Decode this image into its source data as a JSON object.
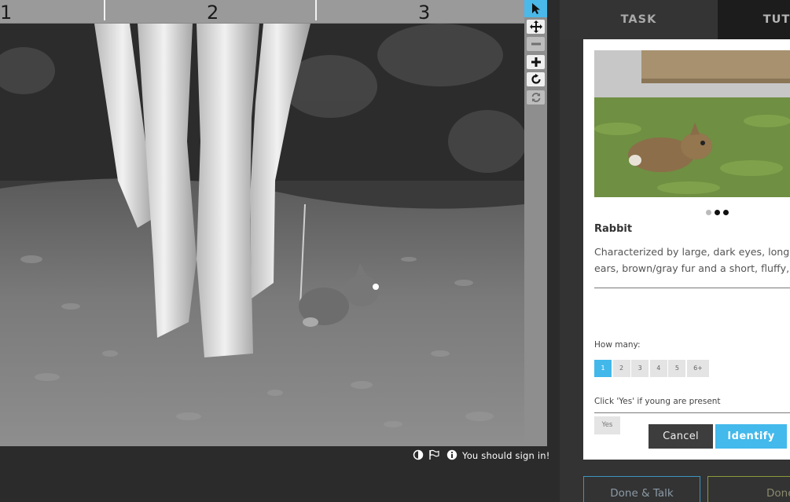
{
  "ruler": {
    "labels": [
      "1",
      "2",
      "3"
    ]
  },
  "viewer_tools": [
    {
      "name": "select-tool",
      "icon": "arrow-pointer-icon"
    },
    {
      "name": "pan-tool",
      "icon": "move-arrows-icon"
    },
    {
      "name": "zoom-out-tool",
      "icon": "minus-icon"
    },
    {
      "name": "zoom-in-tool",
      "icon": "plus-icon"
    },
    {
      "name": "rotate-tool",
      "icon": "rotate-clockwise-icon"
    },
    {
      "name": "reset-tool",
      "icon": "refresh-icon"
    }
  ],
  "footer": {
    "signin_message": "You should sign in!",
    "icons": [
      "invert-contrast-icon",
      "flag-icon",
      "info-icon"
    ]
  },
  "tabs": {
    "task": "TASK",
    "tutorial": "TUT"
  },
  "species": {
    "name": "Rabbit",
    "description_line1": "Characterized by large, dark eyes, long p",
    "description_line2": "ears, brown/gray fur and a short, fluffy,",
    "gallery_count": 3,
    "gallery_selected": 0
  },
  "questions": {
    "how_many_label": "How many:",
    "count_options": [
      "1",
      "2",
      "3",
      "4",
      "5",
      "6+"
    ],
    "count_selected": "1",
    "young_label": "Click 'Yes' if young are present",
    "yes_label": "Yes"
  },
  "actions": {
    "cancel": "Cancel",
    "identify": "Identify",
    "done_talk": "Done & Talk",
    "done": "Done"
  },
  "colors": {
    "accent": "#43b9ec",
    "panel_bg": "#333333",
    "done_border": "#8b9a3a",
    "done_talk_border": "#3c95c0"
  }
}
